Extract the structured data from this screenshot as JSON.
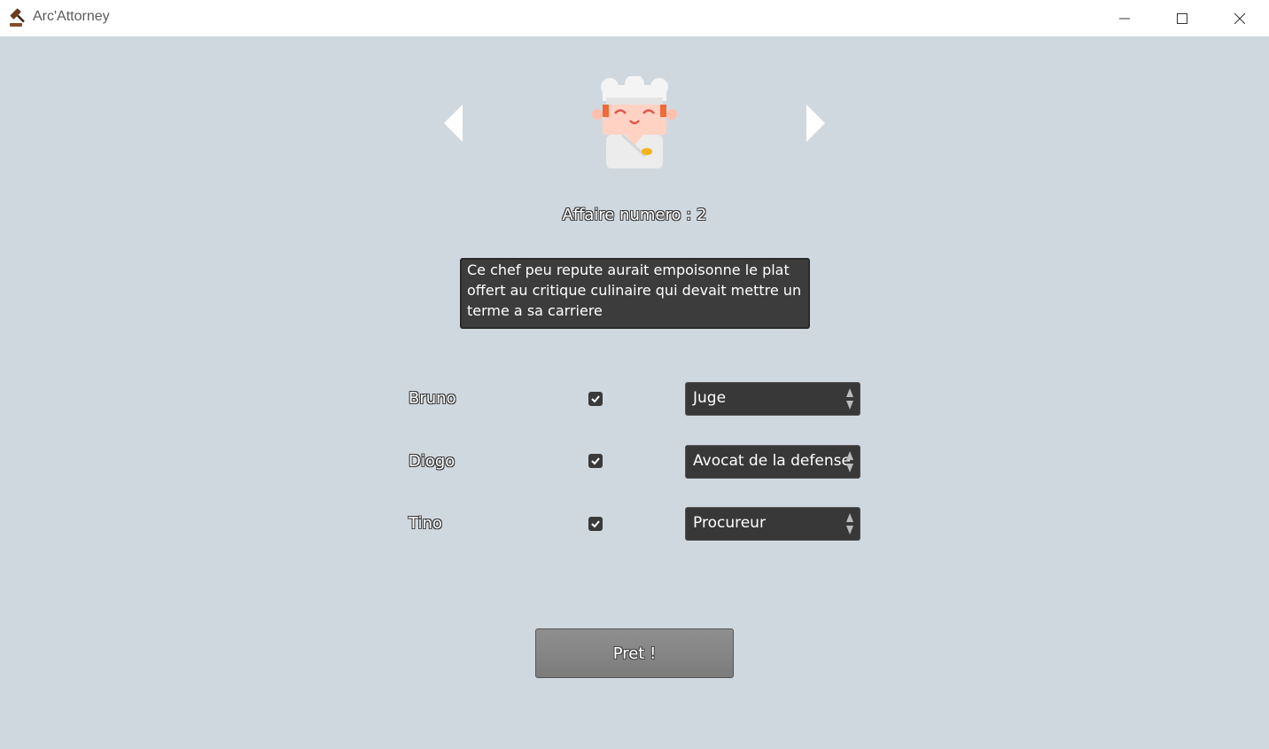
{
  "window": {
    "title": "Arc'Attorney",
    "icon": "gavel-icon"
  },
  "case": {
    "number_label": "Affaire numero : 2",
    "description": "Ce chef peu repute aurait empoisonne le plat offert au critique culinaire qui devait mettre un terme a sa carriere",
    "avatar": "chef-avatar-icon"
  },
  "players": [
    {
      "name": "Bruno",
      "checked": true,
      "role": "Juge"
    },
    {
      "name": "Diogo",
      "checked": true,
      "role": "Avocat de la defense"
    },
    {
      "name": "Tino",
      "checked": true,
      "role": "Procureur"
    }
  ],
  "ready_button": {
    "label": "Pret !"
  },
  "colors": {
    "background": "#d0d8df",
    "description_bg": "#3c3c3c",
    "select_bg": "#383838",
    "button_bg": "#888888"
  }
}
